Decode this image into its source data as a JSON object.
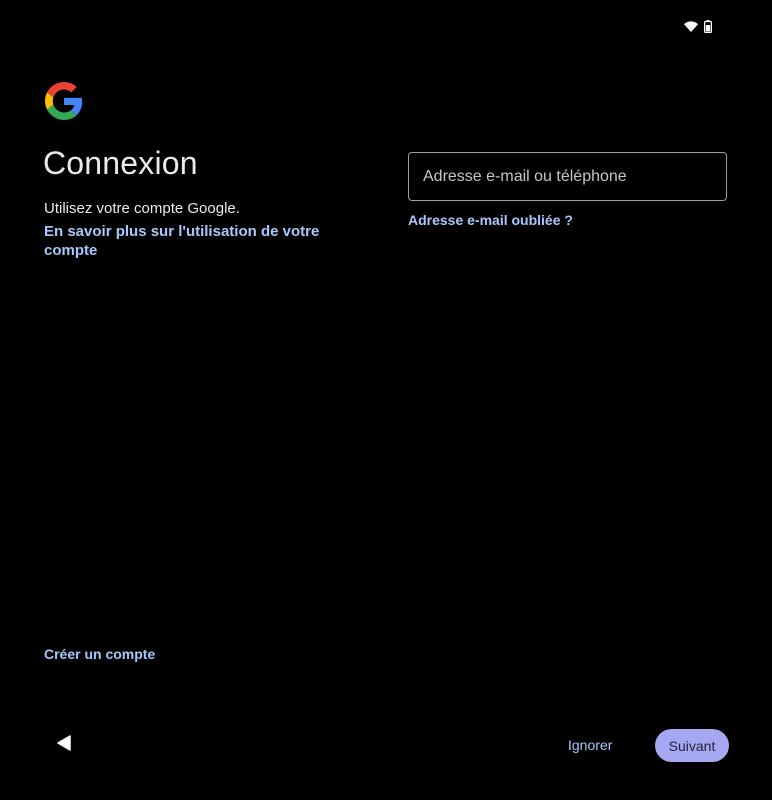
{
  "status_bar": {
    "icons": [
      "wifi-icon",
      "battery-icon"
    ]
  },
  "brand": {
    "logo": "google-logo",
    "colors": {
      "blue": "#4285F4",
      "red": "#EA4335",
      "yellow": "#FBBC05",
      "green": "#34A853"
    }
  },
  "signin": {
    "title": "Connexion",
    "subtitle": "Utilisez votre compte Google.",
    "learn_more": "En savoir plus sur l'utilisation de votre compte",
    "email_placeholder": "Adresse e-mail ou téléphone",
    "email_value": "",
    "forgot_email": "Adresse e-mail oubliée ?",
    "create_account": "Créer un compte"
  },
  "footer": {
    "back_icon": "back-triangle-icon",
    "skip_label": "Ignorer",
    "next_label": "Suivant"
  },
  "theme": {
    "background": "#000000",
    "text": "#e8eaed",
    "link": "#a8c7fa",
    "primary_button": "#a5a8f0"
  }
}
